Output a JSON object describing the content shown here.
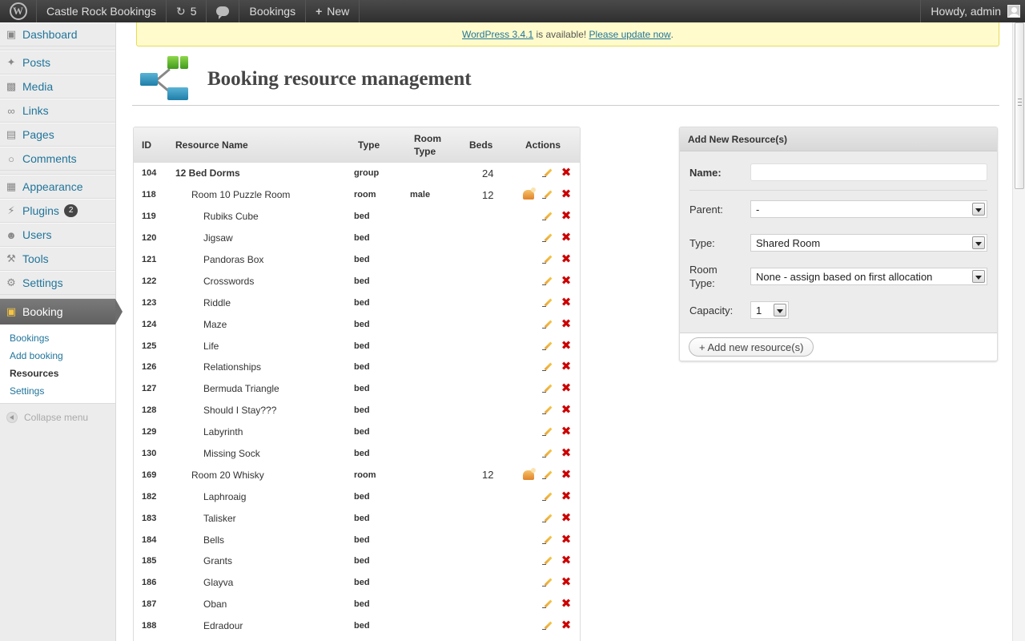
{
  "adminbar": {
    "site_name": "Castle Rock Bookings",
    "updates_count": "5",
    "bookings_label": "Bookings",
    "new_label": "New",
    "howdy": "Howdy, admin"
  },
  "sidebar": {
    "items": [
      {
        "label": "Dashboard",
        "icon": "dashboard-icon"
      },
      {
        "label": "Posts",
        "icon": "pushpin-icon"
      },
      {
        "label": "Media",
        "icon": "media-icon"
      },
      {
        "label": "Links",
        "icon": "link-icon"
      },
      {
        "label": "Pages",
        "icon": "page-icon"
      },
      {
        "label": "Comments",
        "icon": "comment-icon"
      },
      {
        "label": "Appearance",
        "icon": "appearance-icon"
      },
      {
        "label": "Plugins",
        "icon": "plugin-icon",
        "badge": "2"
      },
      {
        "label": "Users",
        "icon": "users-icon"
      },
      {
        "label": "Tools",
        "icon": "tools-icon"
      },
      {
        "label": "Settings",
        "icon": "settings-icon"
      },
      {
        "label": "Booking",
        "icon": "booking-icon"
      }
    ],
    "submenu": [
      "Bookings",
      "Add booking",
      "Resources",
      "Settings"
    ],
    "collapse": "Collapse menu"
  },
  "notice": {
    "link1": "WordPress 3.4.1",
    "middle": " is available! ",
    "link2": "Please update now",
    "end": "."
  },
  "page": {
    "title": "Booking resource management"
  },
  "table": {
    "headers": {
      "id": "ID",
      "name": "Resource Name",
      "type": "Type",
      "room_type": "Room Type",
      "beds": "Beds",
      "actions": "Actions"
    },
    "rows": [
      {
        "id": "104",
        "name": "12 Bed Dorms",
        "type": "group",
        "room_type": "",
        "beds": "24",
        "level": 0
      },
      {
        "id": "118",
        "name": "Room 10 Puzzle Room",
        "type": "room",
        "room_type": "male",
        "beds": "12",
        "level": 1
      },
      {
        "id": "119",
        "name": "Rubiks Cube",
        "type": "bed",
        "room_type": "",
        "beds": "",
        "level": 2
      },
      {
        "id": "120",
        "name": "Jigsaw",
        "type": "bed",
        "room_type": "",
        "beds": "",
        "level": 2
      },
      {
        "id": "121",
        "name": "Pandoras Box",
        "type": "bed",
        "room_type": "",
        "beds": "",
        "level": 2
      },
      {
        "id": "122",
        "name": "Crosswords",
        "type": "bed",
        "room_type": "",
        "beds": "",
        "level": 2
      },
      {
        "id": "123",
        "name": "Riddle",
        "type": "bed",
        "room_type": "",
        "beds": "",
        "level": 2
      },
      {
        "id": "124",
        "name": "Maze",
        "type": "bed",
        "room_type": "",
        "beds": "",
        "level": 2
      },
      {
        "id": "125",
        "name": "Life",
        "type": "bed",
        "room_type": "",
        "beds": "",
        "level": 2
      },
      {
        "id": "126",
        "name": "Relationships",
        "type": "bed",
        "room_type": "",
        "beds": "",
        "level": 2
      },
      {
        "id": "127",
        "name": "Bermuda Triangle",
        "type": "bed",
        "room_type": "",
        "beds": "",
        "level": 2
      },
      {
        "id": "128",
        "name": "Should I Stay???",
        "type": "bed",
        "room_type": "",
        "beds": "",
        "level": 2
      },
      {
        "id": "129",
        "name": "Labyrinth",
        "type": "bed",
        "room_type": "",
        "beds": "",
        "level": 2
      },
      {
        "id": "130",
        "name": "Missing Sock",
        "type": "bed",
        "room_type": "",
        "beds": "",
        "level": 2
      },
      {
        "id": "169",
        "name": "Room 20 Whisky",
        "type": "room",
        "room_type": "",
        "beds": "12",
        "level": 1
      },
      {
        "id": "182",
        "name": "Laphroaig",
        "type": "bed",
        "room_type": "",
        "beds": "",
        "level": 2
      },
      {
        "id": "183",
        "name": "Talisker",
        "type": "bed",
        "room_type": "",
        "beds": "",
        "level": 2
      },
      {
        "id": "184",
        "name": "Bells",
        "type": "bed",
        "room_type": "",
        "beds": "",
        "level": 2
      },
      {
        "id": "185",
        "name": "Grants",
        "type": "bed",
        "room_type": "",
        "beds": "",
        "level": 2
      },
      {
        "id": "186",
        "name": "Glayva",
        "type": "bed",
        "room_type": "",
        "beds": "",
        "level": 2
      },
      {
        "id": "187",
        "name": "Oban",
        "type": "bed",
        "room_type": "",
        "beds": "",
        "level": 2
      },
      {
        "id": "188",
        "name": "Edradour",
        "type": "bed",
        "room_type": "",
        "beds": "",
        "level": 2
      }
    ]
  },
  "panel": {
    "title": "Add New Resource(s)",
    "name_label": "Name:",
    "name_value": "",
    "parent_label": "Parent:",
    "parent_value": "-",
    "type_label": "Type:",
    "type_value": "Shared Room",
    "room_type_label_1": "Room",
    "room_type_label_2": "Type:",
    "room_type_value": "None - assign based on first allocation",
    "capacity_label": "Capacity:",
    "capacity_value": "1",
    "add_button": "+ Add new resource(s)"
  }
}
